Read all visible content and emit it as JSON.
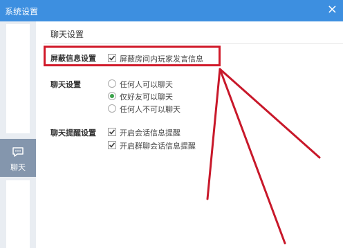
{
  "window": {
    "title": "系统设置",
    "close_glyph": "×"
  },
  "sidebar": {
    "items": [
      {
        "label": "聊天",
        "icon": "chat-bubble-icon",
        "active": true
      }
    ]
  },
  "main": {
    "title": "聊天设置",
    "sections": [
      {
        "label": "屏蔽信息设置",
        "options": [
          {
            "type": "checkbox",
            "label": "屏蔽房间内玩家发言信息",
            "checked": true
          }
        ]
      },
      {
        "label": "聊天设置",
        "options": [
          {
            "type": "radio",
            "label": "任何人可以聊天",
            "checked": false
          },
          {
            "type": "radio",
            "label": "仅好友可以聊天",
            "checked": true
          },
          {
            "type": "radio",
            "label": "任何人不可以聊天",
            "checked": false
          }
        ]
      },
      {
        "label": "聊天提醒设置",
        "options": [
          {
            "type": "checkbox",
            "label": "开启会话信息提醒",
            "checked": true
          },
          {
            "type": "checkbox",
            "label": "开启群聊会话信息提醒",
            "checked": true
          }
        ]
      }
    ]
  },
  "colors": {
    "titlebar": "#3d8fe0",
    "active_nav": "#8496ad",
    "annotation": "#d11a2a",
    "radio_on": "#3aa24a"
  }
}
